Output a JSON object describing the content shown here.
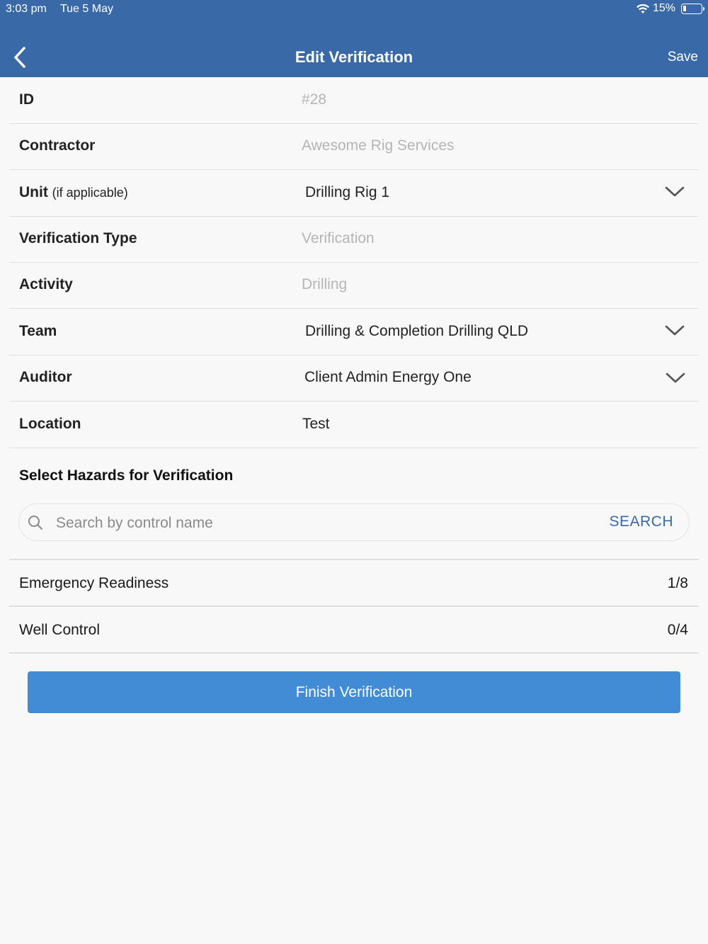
{
  "status_bar": {
    "time": "3:03 pm",
    "date": "Tue 5 May",
    "battery": "15%"
  },
  "nav": {
    "title": "Edit Verification",
    "save_label": "Save"
  },
  "form": {
    "id": {
      "label": "ID",
      "value": "#28"
    },
    "contractor": {
      "label": "Contractor",
      "value": "Awesome Rig Services"
    },
    "unit": {
      "label": "Unit",
      "label_note": "(if applicable)",
      "value": "Drilling Rig 1"
    },
    "verification_type": {
      "label": "Verification Type",
      "value": "Verification"
    },
    "activity": {
      "label": "Activity",
      "value": "Drilling"
    },
    "team": {
      "label": "Team",
      "value": "Drilling & Completion Drilling QLD"
    },
    "auditor": {
      "label": "Auditor",
      "value": "Client Admin Energy One"
    },
    "location": {
      "label": "Location",
      "value": "Test"
    }
  },
  "hazards": {
    "title": "Select Hazards for Verification",
    "search": {
      "placeholder": "Search by control name",
      "value": "",
      "button_label": "SEARCH"
    },
    "items": [
      {
        "name": "Emergency Readiness",
        "count": "1/8"
      },
      {
        "name": "Well Control",
        "count": "0/4"
      }
    ]
  },
  "finish_label": "Finish Verification",
  "colors": {
    "header": "#3a69a8",
    "button": "#428cd6",
    "accent": "#3a69a8"
  }
}
